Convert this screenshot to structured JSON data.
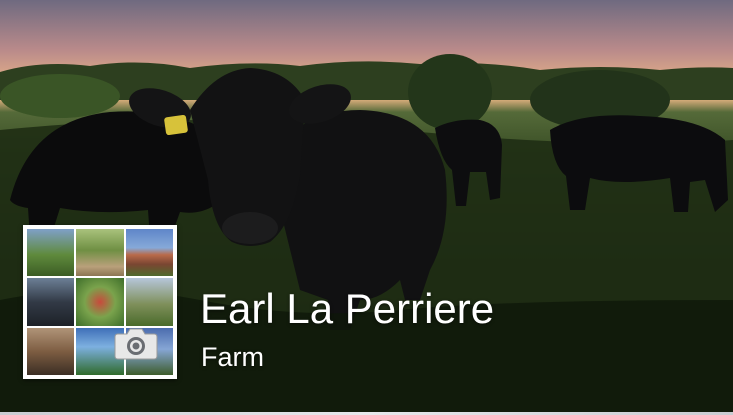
{
  "page": {
    "name": "Earl La Perriere",
    "category": "Farm"
  },
  "cover_photo": {
    "subject": "cattle-in-pasture-at-sunset"
  },
  "profile_photo": {
    "type": "collage",
    "edit_icon": "camera-icon"
  },
  "colors": {
    "name_text": "#ffffff",
    "frame": "#ffffff"
  }
}
